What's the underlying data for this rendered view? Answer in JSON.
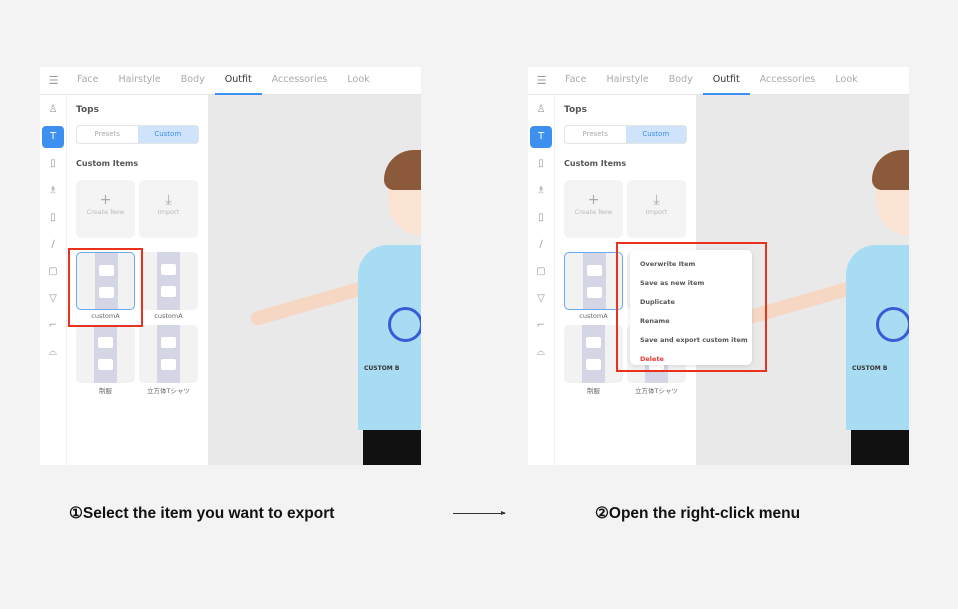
{
  "tabs": [
    "Face",
    "Hairstyle",
    "Body",
    "Outfit",
    "Accessories",
    "Look"
  ],
  "active_tab": "Outfit",
  "sidebar_icons": [
    "tops-dress-icon",
    "shirt-icon",
    "pants-icon",
    "dress-icon",
    "sock-icon",
    "glove-icon",
    "tank-top-icon",
    "underwear-icon",
    "boot-icon",
    "shoe-icon"
  ],
  "section_title": "Tops",
  "segment": {
    "presets": "Presets",
    "custom": "Custom",
    "selected": "Custom"
  },
  "custom_items_title": "Custom Items",
  "create_new": "Create New",
  "import": "Import",
  "items": [
    "customA",
    "customA",
    "制服",
    "立方体Tシャツ"
  ],
  "context_menu": [
    "Overwrite Item",
    "Save as new item",
    "Duplicate",
    "Rename",
    "Save and export custom item",
    "Delete"
  ],
  "shirt_print": "CUSTOM B",
  "captions": {
    "step1": "①Select the item you want to export",
    "step2": "②Open the right-click menu"
  },
  "colors": {
    "accent": "#3d8ff0",
    "highlight": "#e8321e",
    "delete": "#e53935",
    "shirt": "#a8dcf3"
  }
}
